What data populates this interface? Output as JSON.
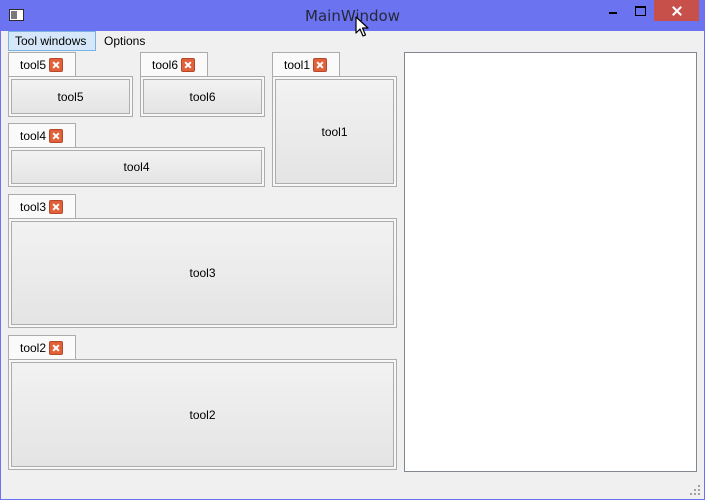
{
  "window": {
    "title": "MainWindow"
  },
  "menubar": {
    "items": [
      {
        "label": "Tool windows"
      },
      {
        "label": "Options"
      }
    ]
  },
  "docks": [
    {
      "tab_label": "tool5",
      "button_label": "tool5"
    },
    {
      "tab_label": "tool6",
      "button_label": "tool6"
    },
    {
      "tab_label": "tool1",
      "button_label": "tool1"
    },
    {
      "tab_label": "tool4",
      "button_label": "tool4"
    },
    {
      "tab_label": "tool3",
      "button_label": "tool3"
    },
    {
      "tab_label": "tool2",
      "button_label": "tool2"
    }
  ],
  "icons": {
    "app": "app-window-icon",
    "minimize": "minimize-icon",
    "maximize": "maximize-icon",
    "close": "close-icon",
    "tab_close": "close-x-icon",
    "size_grip": "resize-grip-icon",
    "cursor": "mouse-pointer-icon"
  },
  "colors": {
    "titlebar": "#6b73f0",
    "close_button": "#c7504b",
    "tab_close": "#e0613a",
    "menu_active_bg": "#d5e7f8",
    "menu_active_border": "#7ab3e6",
    "client_bg": "#f0f0f0",
    "central_bg": "#ffffff"
  }
}
